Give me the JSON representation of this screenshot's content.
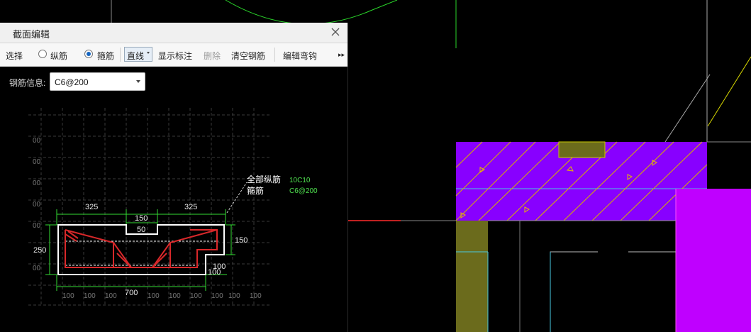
{
  "window": {
    "title": "截面编辑"
  },
  "toolbar": {
    "select": "选择",
    "longitudinal": "纵筋",
    "stirrup": "箍筋",
    "line_mode": "直线",
    "show_dims": "显示标注",
    "delete": "删除",
    "clear_rebar": "清空钢筋",
    "edit_hook": "编辑弯钩",
    "more": "▸▸"
  },
  "rebar_info": {
    "label": "钢筋信息:",
    "value": "C6@200"
  },
  "drawing": {
    "dims_top": [
      "325",
      "150",
      "325"
    ],
    "dim_notch": "50",
    "dim_left": "250",
    "dim_right": "150",
    "dim_step_v": "100",
    "dim_step_h": "100",
    "dim_width": "700",
    "grid_label": "00",
    "bottom_grid": "100",
    "note_all_long": "全部纵筋",
    "note_stirrup": "箍筋",
    "val_all_long": "10C10",
    "val_stirrup": "C6@200"
  },
  "colors": {
    "purple": "#8800ff",
    "magenta": "#bf00ff",
    "olive": "#6b6b1c",
    "rebar_red": "#d8282a",
    "dim_green": "#33dd33"
  }
}
